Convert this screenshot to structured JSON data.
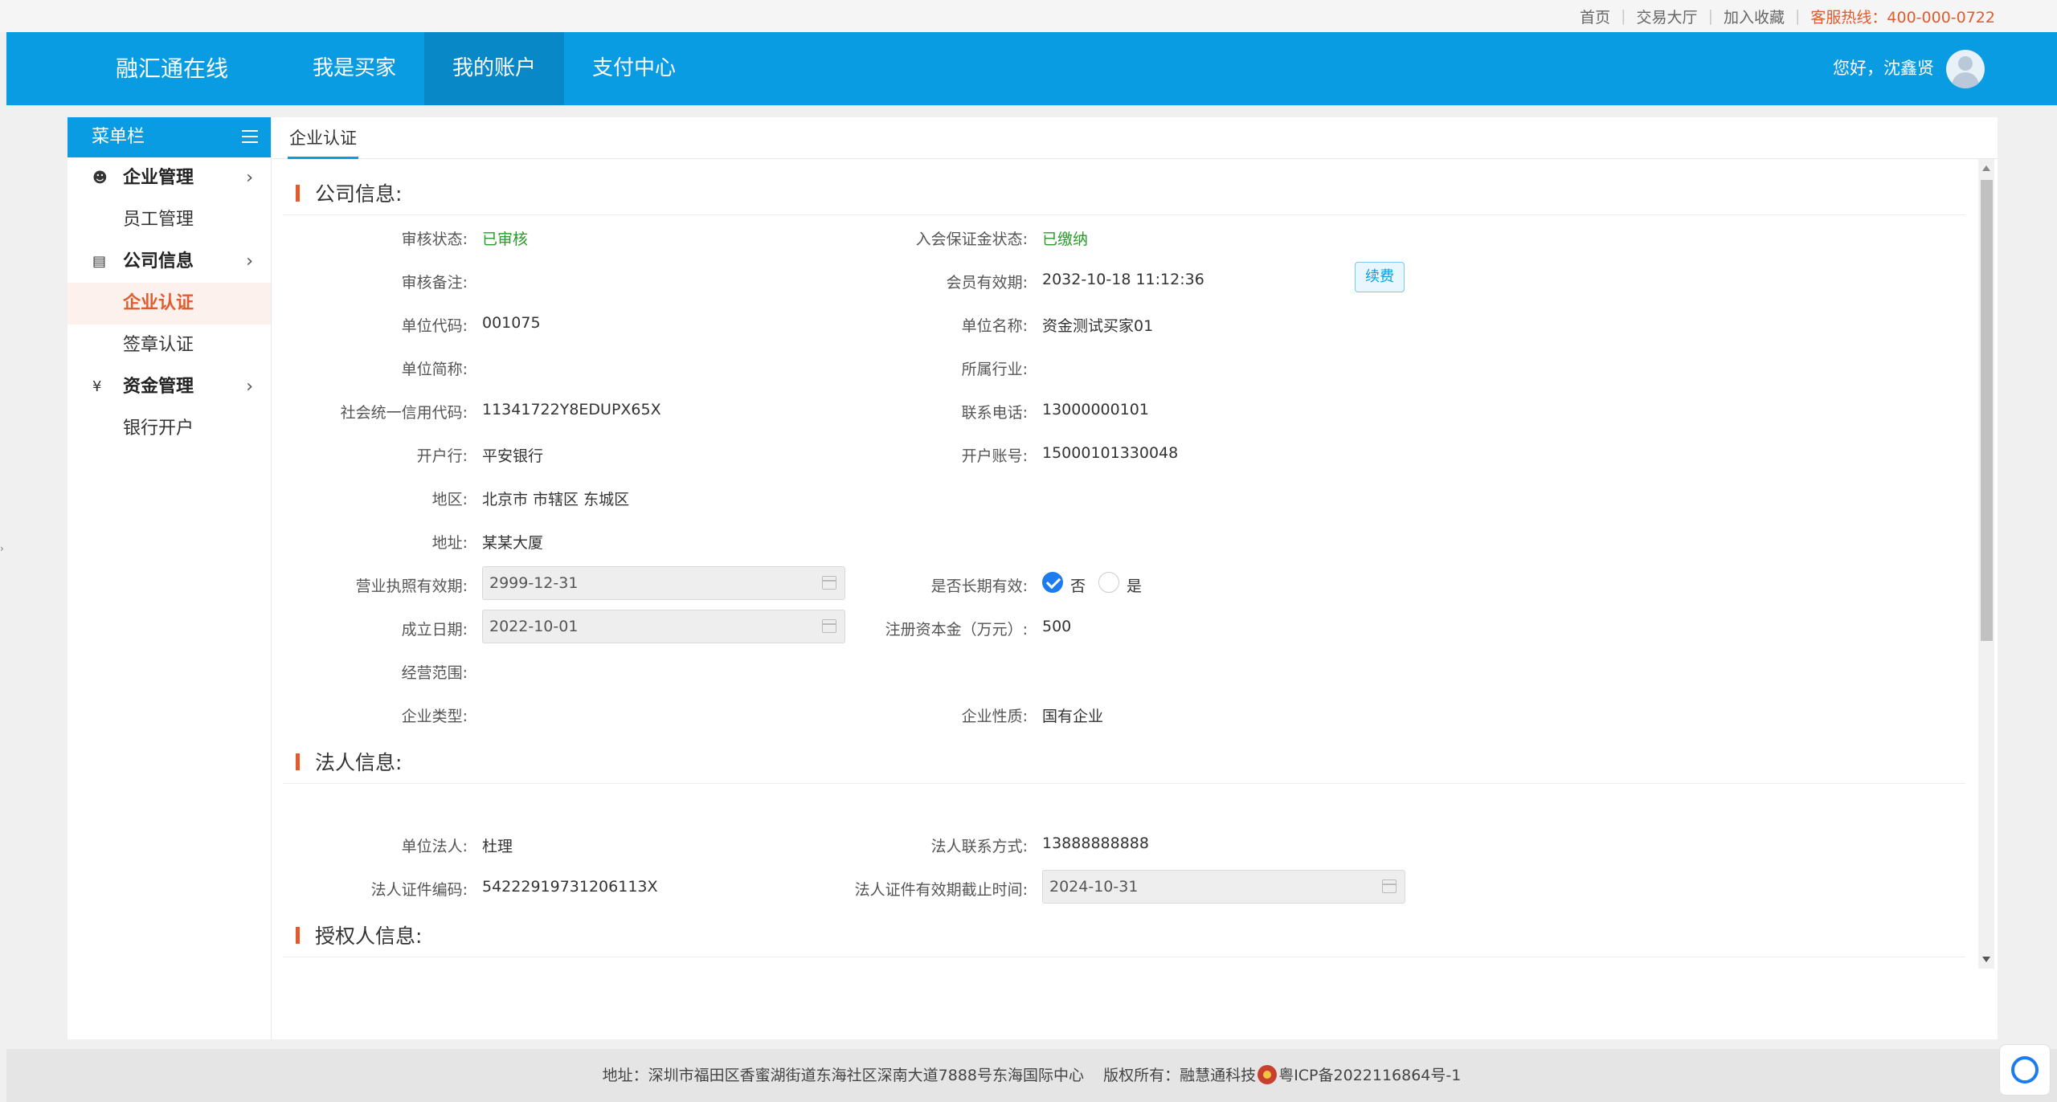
{
  "toplinks": {
    "home": "首页",
    "trade_hall": "交易大厅",
    "favorite": "加入收藏",
    "hotline": "客服热线：400-000-0722"
  },
  "header": {
    "brand": "融汇通在线",
    "nav": [
      "我是买家",
      "我的账户",
      "支付中心"
    ],
    "active_nav": "我的账户",
    "greeting": "您好，沈鑫贤"
  },
  "sidebar": {
    "title": "菜单栏",
    "groups": [
      {
        "label": "企业管理",
        "icon": "users-icon",
        "items": [
          "员工管理"
        ]
      },
      {
        "label": "公司信息",
        "icon": "id-card-icon",
        "items": [
          "企业认证",
          "签章认证"
        ]
      },
      {
        "label": "资金管理",
        "icon": "yuan-icon",
        "items": [
          "银行开户"
        ]
      }
    ],
    "active_item": "企业认证"
  },
  "tab": "企业认证",
  "sections": {
    "company": "公司信息:",
    "legal": "法人信息:",
    "authorized": "授权人信息:"
  },
  "company": {
    "audit_status_label": "审核状态:",
    "audit_status": "已审核",
    "deposit_status_label": "入会保证金状态:",
    "deposit_status": "已缴纳",
    "audit_note_label": "审核备注:",
    "audit_note": "",
    "member_valid_label": "会员有效期:",
    "member_valid": "2032-10-18 11:12:36",
    "renew_button": "续费",
    "unit_code_label": "单位代码:",
    "unit_code": "001075",
    "unit_name_label": "单位名称:",
    "unit_name": "资金测试买家01",
    "short_name_label": "单位简称:",
    "short_name": "",
    "industry_label": "所属行业:",
    "industry": "",
    "credit_code_label": "社会统一信用代码:",
    "credit_code": "11341722Y8EDUPX65X",
    "phone_label": "联系电话:",
    "phone": "13000000101",
    "bank_label": "开户行:",
    "bank": "平安银行",
    "account_label": "开户账号:",
    "account": "15000101330048",
    "region_label": "地区:",
    "region": "北京市 市辖区 东城区",
    "address_label": "地址:",
    "address": "某某大厦",
    "license_valid_label": "营业执照有效期:",
    "license_valid": "2999-12-31",
    "long_term_label": "是否长期有效:",
    "long_term_no": "否",
    "long_term_yes": "是",
    "found_date_label": "成立日期:",
    "found_date": "2022-10-01",
    "capital_label": "注册资本金（万元）:",
    "capital": "500",
    "scope_label": "经营范围:",
    "scope": "",
    "type_label": "企业类型:",
    "type": "",
    "nature_label": "企业性质:",
    "nature": "国有企业"
  },
  "legal": {
    "person_label": "单位法人:",
    "person": "杜理",
    "contact_label": "法人联系方式:",
    "contact": "13888888888",
    "id_label": "法人证件编码:",
    "id": "54222919731206113X",
    "id_expire_label": "法人证件有效期截止时间:",
    "id_expire": "2024-10-31"
  },
  "footer": {
    "address": "地址：深圳市福田区香蜜湖街道东海社区深南大道7888号东海国际中心",
    "copyright": "版权所有：融慧通科技",
    "icp": "粤ICP备2022116864号-1"
  }
}
